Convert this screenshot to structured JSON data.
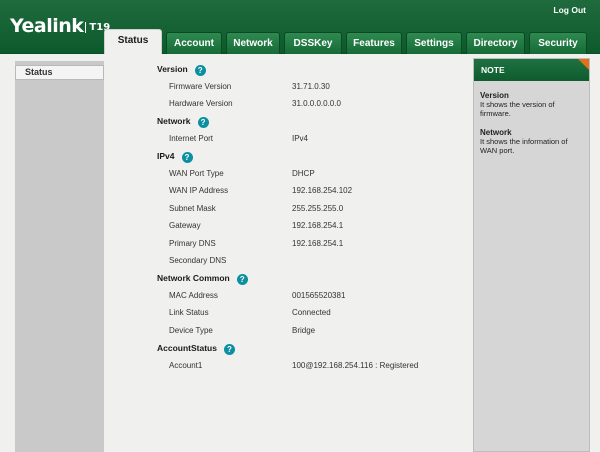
{
  "header": {
    "brand": "Yealink",
    "model": "T19",
    "logout": "Log Out"
  },
  "tabs": [
    {
      "label": "Status",
      "active": true
    },
    {
      "label": "Account"
    },
    {
      "label": "Network"
    },
    {
      "label": "DSSKey"
    },
    {
      "label": "Features"
    },
    {
      "label": "Settings"
    },
    {
      "label": "Directory"
    },
    {
      "label": "Security"
    }
  ],
  "sidebar": {
    "items": [
      {
        "label": "Status"
      }
    ]
  },
  "sections": {
    "version": {
      "title": "Version",
      "rows": [
        {
          "label": "Firmware Version",
          "value": "31.71.0.30"
        },
        {
          "label": "Hardware Version",
          "value": "31.0.0.0.0.0.0"
        }
      ]
    },
    "network": {
      "title": "Network",
      "rows": [
        {
          "label": "Internet Port",
          "value": "IPv4"
        }
      ]
    },
    "ipv4": {
      "title": "IPv4",
      "rows": [
        {
          "label": "WAN Port Type",
          "value": "DHCP"
        },
        {
          "label": "WAN IP Address",
          "value": "192.168.254.102"
        },
        {
          "label": "Subnet Mask",
          "value": "255.255.255.0"
        },
        {
          "label": "Gateway",
          "value": "192.168.254.1"
        },
        {
          "label": "Primary DNS",
          "value": "192.168.254.1"
        },
        {
          "label": "Secondary DNS",
          "value": ""
        }
      ]
    },
    "network_common": {
      "title": "Network Common",
      "rows": [
        {
          "label": "MAC Address",
          "value": "001565520381"
        },
        {
          "label": "Link Status",
          "value": "Connected"
        },
        {
          "label": "Device Type",
          "value": "Bridge"
        }
      ]
    },
    "account_status": {
      "title": "AccountStatus",
      "rows": [
        {
          "label": "Account1",
          "value": "100@192.168.254.116 : Registered"
        }
      ]
    }
  },
  "note": {
    "title": "NOTE",
    "items": [
      {
        "title": "Version",
        "text": "It shows the version of firmware."
      },
      {
        "title": "Network",
        "text": "It shows the information of WAN port."
      }
    ]
  },
  "colors": {
    "header_green": "#0d5a2c",
    "help_icon": "#0c8fa0",
    "note_corner": "#e0701c"
  },
  "icons": {
    "help": "question-circle-icon"
  }
}
